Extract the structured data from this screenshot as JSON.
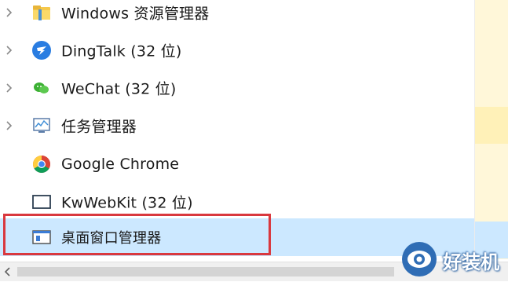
{
  "processes": [
    {
      "label": "Windows 资源管理器",
      "icon": "folder-icon",
      "expandable": true,
      "selected": false
    },
    {
      "label": "DingTalk (32 位)",
      "icon": "dingtalk-icon",
      "expandable": true,
      "selected": false
    },
    {
      "label": "WeChat (32 位)",
      "icon": "wechat-icon",
      "expandable": true,
      "selected": false
    },
    {
      "label": "任务管理器",
      "icon": "task-manager-icon",
      "expandable": true,
      "selected": false
    },
    {
      "label": "Google Chrome",
      "icon": "chrome-icon",
      "expandable": false,
      "selected": false
    },
    {
      "label": "KwWebKit (32 位)",
      "icon": "window-icon",
      "expandable": false,
      "selected": false
    },
    {
      "label": "桌面窗口管理器",
      "icon": "desktop-window-manager-icon",
      "expandable": false,
      "selected": true
    }
  ],
  "highlight_color": "#d9383e",
  "selection_color": "#cce8ff",
  "watermark": {
    "text": "好装机",
    "icon": "eye-logo-icon"
  }
}
